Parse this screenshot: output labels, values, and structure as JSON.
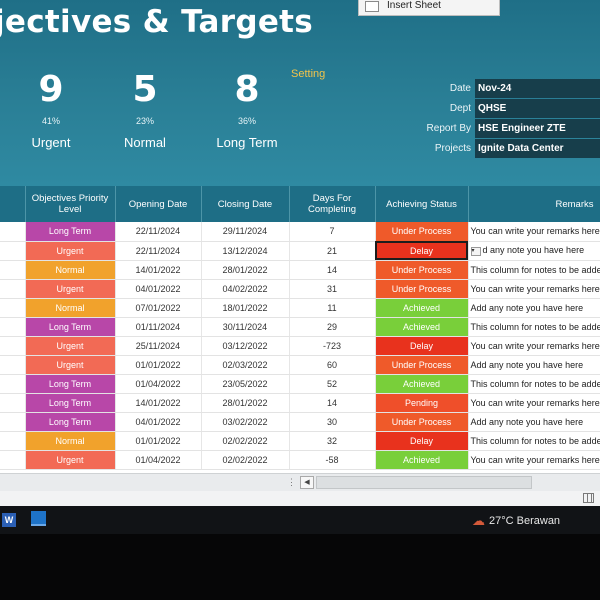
{
  "header": {
    "title": "jectives & Targets",
    "insert_sheet_label": "Insert Sheet",
    "setting_label": "Setting"
  },
  "kpis": [
    {
      "value": "9",
      "percent": "41%",
      "label": "Urgent"
    },
    {
      "value": "5",
      "percent": "23%",
      "label": "Normal"
    },
    {
      "value": "8",
      "percent": "36%",
      "label": "Long Term"
    }
  ],
  "info": [
    {
      "key": "Date",
      "value": "Nov-24"
    },
    {
      "key": "Dept",
      "value": "QHSE"
    },
    {
      "key": "Report By",
      "value": "HSE Engineer ZTE"
    },
    {
      "key": "Projects",
      "value": "Ignite Data Center"
    }
  ],
  "table": {
    "columns": [
      "Objectives Priority Level",
      "Opening Date",
      "Closing Date",
      "Days For Completing",
      "Achieving Status",
      "Remarks"
    ],
    "rows": [
      {
        "priority": "Long Term",
        "open": "22/11/2024",
        "close": "29/11/2024",
        "days": "7",
        "status": "Under Process",
        "remark": "You can write your remarks here"
      },
      {
        "priority": "Urgent",
        "open": "22/11/2024",
        "close": "13/12/2024",
        "days": "21",
        "status": "Delay",
        "remark": "d any note you have here"
      },
      {
        "priority": "Normal",
        "open": "14/01/2022",
        "close": "28/01/2022",
        "days": "14",
        "status": "Under Process",
        "remark": "This column for notes to be adde"
      },
      {
        "priority": "Urgent",
        "open": "04/01/2022",
        "close": "04/02/2022",
        "days": "31",
        "status": "Under Process",
        "remark": "You can write your remarks here"
      },
      {
        "priority": "Normal",
        "open": "07/01/2022",
        "close": "18/01/2022",
        "days": "11",
        "status": "Achieved",
        "remark": "Add any note you have here"
      },
      {
        "priority": "Long Term",
        "open": "01/11/2024",
        "close": "30/11/2024",
        "days": "29",
        "status": "Achieved",
        "remark": "This column for notes to be adde"
      },
      {
        "priority": "Urgent",
        "open": "25/11/2024",
        "close": "03/12/2022",
        "days": "-723",
        "status": "Delay",
        "remark": "You can write your remarks here"
      },
      {
        "priority": "Urgent",
        "open": "01/01/2022",
        "close": "02/03/2022",
        "days": "60",
        "status": "Under Process",
        "remark": "Add any note you have here"
      },
      {
        "priority": "Long Term",
        "open": "01/04/2022",
        "close": "23/05/2022",
        "days": "52",
        "status": "Achieved",
        "remark": "This column for notes to be adde"
      },
      {
        "priority": "Long Term",
        "open": "14/01/2022",
        "close": "28/01/2022",
        "days": "14",
        "status": "Pending",
        "remark": "You can write your remarks here"
      },
      {
        "priority": "Long Term",
        "open": "04/01/2022",
        "close": "03/02/2022",
        "days": "30",
        "status": "Under Process",
        "remark": "Add any note you have here"
      },
      {
        "priority": "Normal",
        "open": "01/01/2022",
        "close": "02/02/2022",
        "days": "32",
        "status": "Delay",
        "remark": "This column for notes to be added"
      },
      {
        "priority": "Urgent",
        "open": "01/04/2022",
        "close": "02/02/2022",
        "days": "-58",
        "status": "Achieved",
        "remark": "You can write your remarks here"
      }
    ]
  },
  "colors": {
    "priority": {
      "Long Term": "#b847a8",
      "Urgent": "#f26a55",
      "Normal": "#f1a22c"
    },
    "status": {
      "Under Process": "#ef5a2a",
      "Delay": "#e8321d",
      "Achieved": "#79cf3a",
      "Pending": "#ef4f2a"
    }
  },
  "taskbar": {
    "word_icon_letter": "W",
    "weather": "27°C  Berawan",
    "weather_icon": "cloud-icon"
  }
}
